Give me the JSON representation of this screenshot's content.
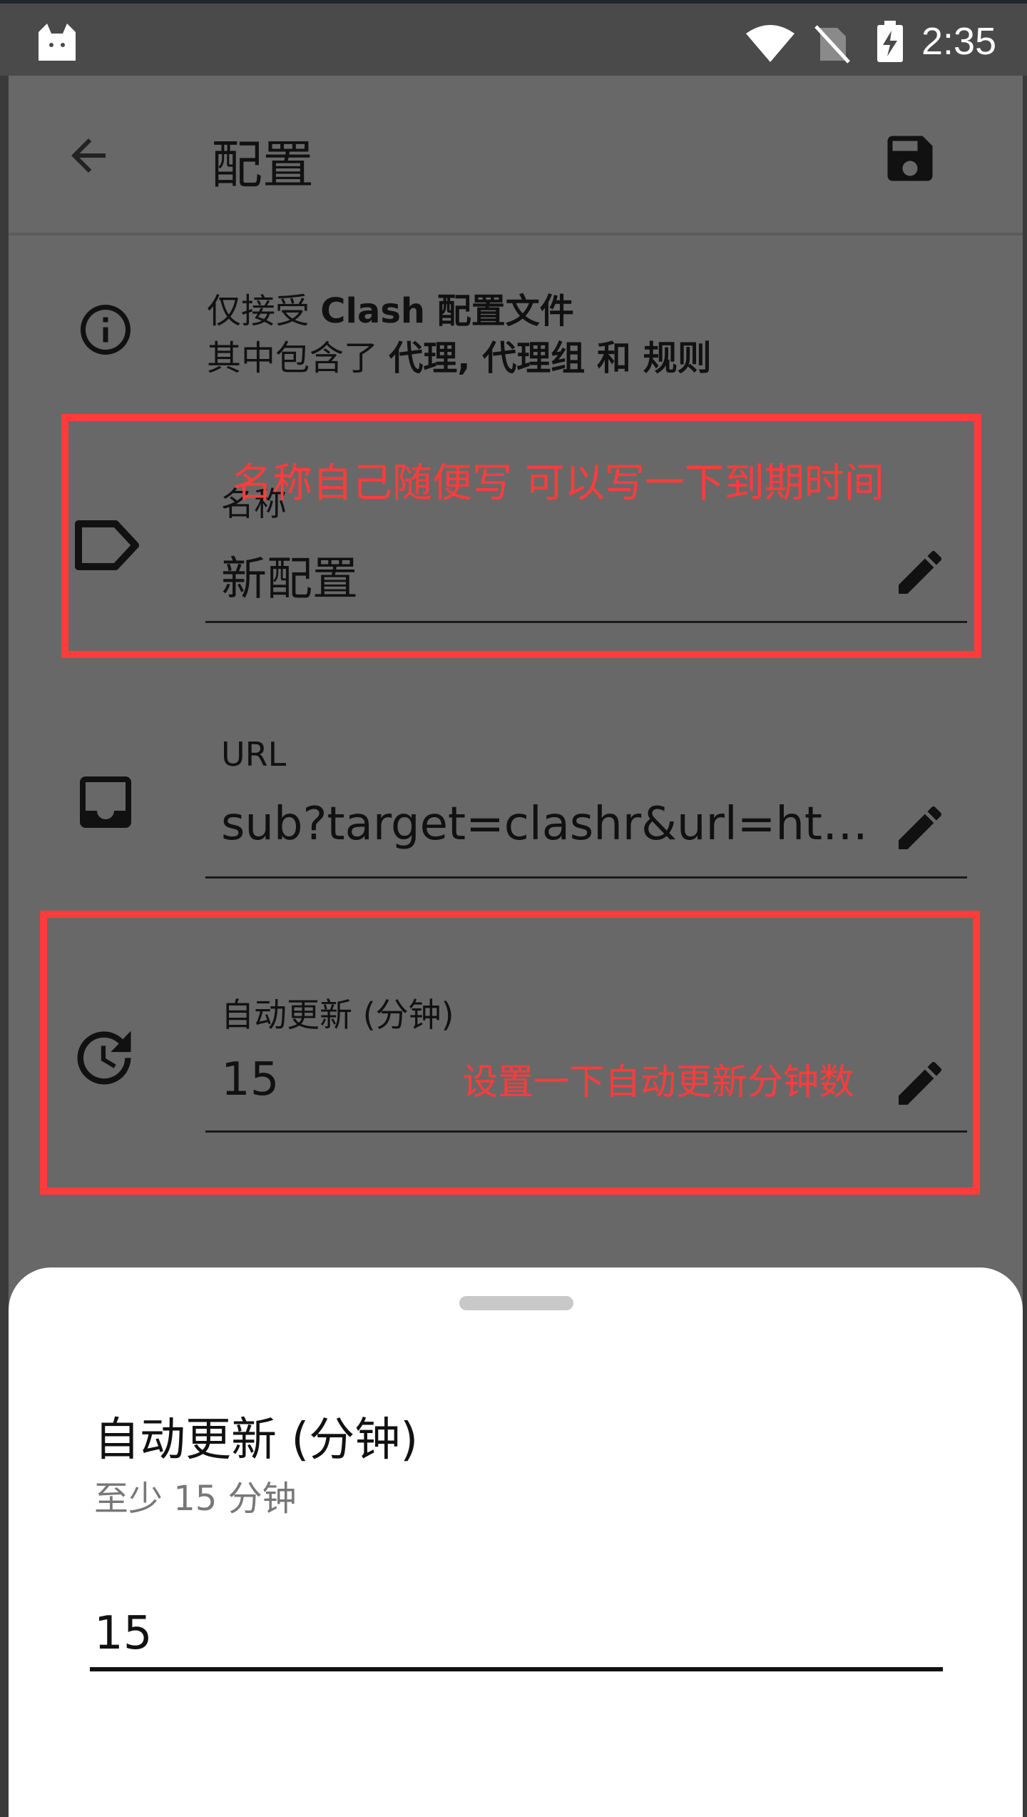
{
  "status_bar": {
    "time": "2:35",
    "icons": [
      "cat-app-icon",
      "wifi-icon",
      "no-sim-icon",
      "battery-charging-icon"
    ]
  },
  "toolbar": {
    "title": "配置",
    "back_icon": "arrow-back-icon",
    "save_icon": "save-icon"
  },
  "info": {
    "icon": "info-icon",
    "line1_prefix": "仅接受 ",
    "line1_bold": "Clash 配置文件",
    "line2_prefix": "其中包含了 ",
    "line2_bold": "代理, 代理组 和 规则"
  },
  "fields": {
    "name": {
      "icon": "label-tag-icon",
      "label": "名称",
      "value": "新配置",
      "edit_icon": "pencil-icon"
    },
    "url": {
      "icon": "inbox-icon",
      "label": "URL",
      "value": "sub?target=clashr&url=http…",
      "edit_icon": "pencil-icon"
    },
    "auto_update": {
      "icon": "update-clock-icon",
      "label": "自动更新 (分钟)",
      "value": "15",
      "edit_icon": "pencil-icon"
    }
  },
  "annotations": {
    "name_note": "名称自己随便写 可以写一下到期时间",
    "update_note": "设置一下自动更新分钟数",
    "color": "#ff3b3b"
  },
  "sheet": {
    "title": "自动更新 (分钟)",
    "subtitle": "至少 15 分钟",
    "input_value": "15"
  },
  "colors": {
    "dim_background": "#686868",
    "sheet_background": "#ffffff",
    "text": "#111111"
  }
}
